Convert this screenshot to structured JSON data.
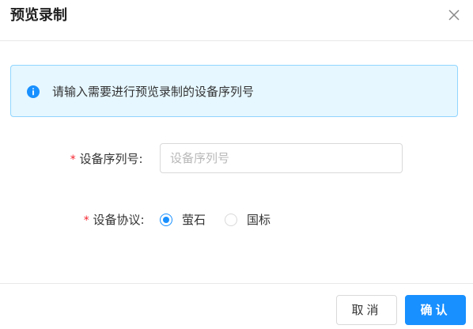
{
  "dialog": {
    "title": "预览录制",
    "close_icon": "close-icon"
  },
  "alert": {
    "icon": "info-icon",
    "message": "请输入需要进行预览录制的设备序列号",
    "colors": {
      "background": "#e6f7ff",
      "border": "#91d5ff",
      "icon": "#1890ff"
    }
  },
  "form": {
    "serial": {
      "required_mark": "*",
      "label": "设备序列号:",
      "value": "",
      "placeholder": "设备序列号"
    },
    "protocol": {
      "required_mark": "*",
      "label": "设备协议:",
      "options": [
        {
          "label": "萤石",
          "checked": true
        },
        {
          "label": "国标",
          "checked": false
        }
      ]
    }
  },
  "footer": {
    "cancel_label": "取消",
    "ok_label": "确认"
  },
  "colors": {
    "primary": "#1890ff",
    "required": "#f5222d"
  }
}
